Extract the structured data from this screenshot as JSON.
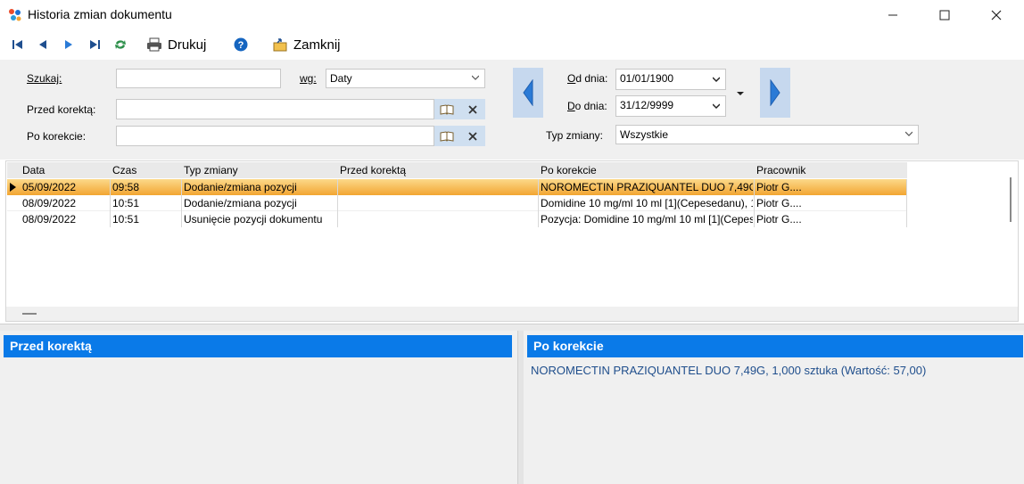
{
  "window": {
    "title": "Historia zmian dokumentu",
    "controls": {
      "minimize": "—",
      "maximize": "☐",
      "close": "✕"
    }
  },
  "toolbar": {
    "first_icon": "first-record-icon",
    "prev_icon": "previous-record-icon",
    "next_icon": "next-record-icon",
    "last_icon": "last-record-icon",
    "refresh_icon": "refresh-icon",
    "print_label": "Drukuj",
    "help_icon": "help-icon",
    "close_label": "Zamknij"
  },
  "filters": {
    "search_label": "Szukaj:",
    "search_value": "",
    "by_label": "wg:",
    "by_value": "Daty",
    "before_label": "Przed korektą:",
    "before_value": "",
    "after_label": "Po korekcie:",
    "after_value": "",
    "from_label": "Od dnia:",
    "from_value": "01/01/1900",
    "to_label": "Do dnia:",
    "to_value": "31/12/9999",
    "type_label": "Typ zmiany:",
    "type_value": "Wszystkie"
  },
  "grid": {
    "columns": [
      "Data",
      "Czas",
      "Typ zmiany",
      "Przed korektą",
      "Po korekcie",
      "Pracownik"
    ],
    "rows": [
      {
        "date": "05/09/2022",
        "time": "09:58",
        "type": "Dodanie/zmiana pozycji",
        "before": "",
        "after": "NOROMECTIN PRAZIQUANTEL DUO 7,49G, 1,",
        "employee": "Piotr G....",
        "selected": true
      },
      {
        "date": "08/09/2022",
        "time": "10:51",
        "type": "Dodanie/zmiana pozycji",
        "before": "",
        "after": "Domidine 10 mg/ml 10 ml [1](Cepesedanu), 1",
        "employee": "Piotr G....",
        "selected": false
      },
      {
        "date": "08/09/2022",
        "time": "10:51",
        "type": "Usunięcie pozycji dokumentu",
        "before": "",
        "after": "Pozycja: Domidine 10 mg/ml 10 ml [1](Cepes",
        "employee": "Piotr G....",
        "selected": false
      }
    ]
  },
  "panels": {
    "before_title": "Przed korektą",
    "before_text": "",
    "after_title": "Po korekcie",
    "after_text": "NOROMECTIN PRAZIQUANTEL DUO 7,49G, 1,000 sztuka (Wartość: 57,00)"
  },
  "colors": {
    "accent": "#0a7ae8",
    "selected_row": "#f2a532",
    "nav_button": "#c6d8ee",
    "nav_arrow": "#2a7ad6"
  }
}
